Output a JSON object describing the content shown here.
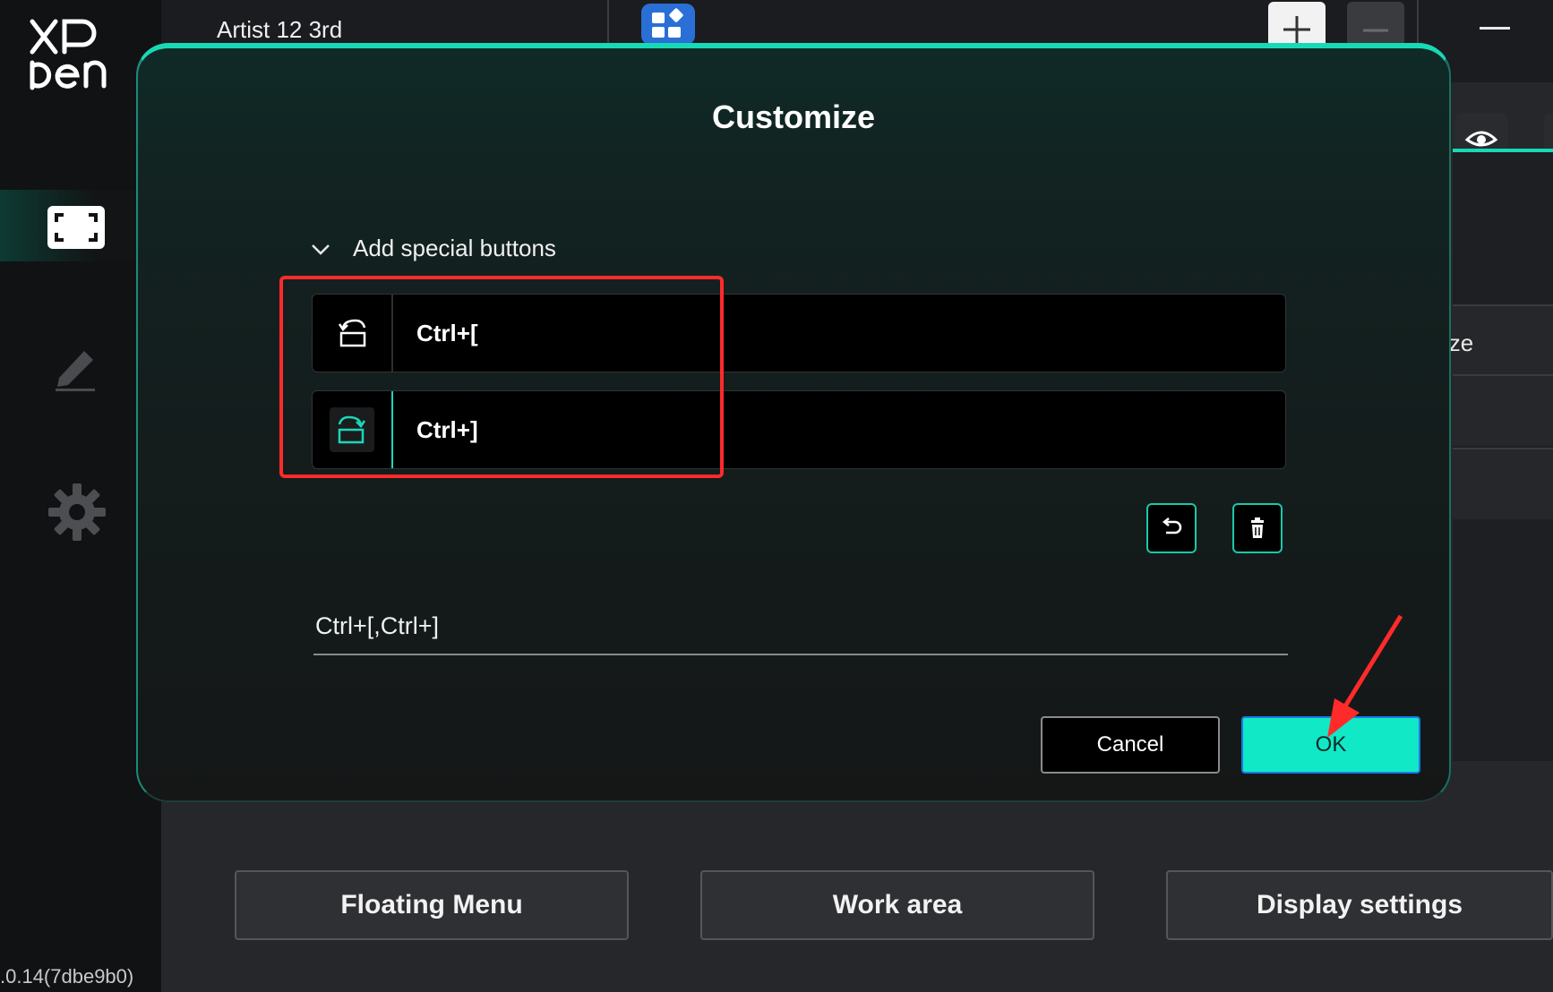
{
  "sidebar": {
    "logo": "XP pen",
    "icons": [
      "display-icon",
      "pen-icon",
      "settings-gear-icon"
    ],
    "version": ".0.14(7dbe9b0)"
  },
  "topbar": {
    "device_name": "Artist 12 3rd",
    "icons": [
      "app-grid-icon",
      "plus-icon",
      "minus-icon",
      "window-minimize-icon"
    ]
  },
  "background": {
    "peek_text": "ize",
    "buttons": [
      "Floating Menu",
      "Work area",
      "Display settings"
    ]
  },
  "modal": {
    "title": "Customize",
    "section_label": "Add special buttons",
    "keys": [
      {
        "icon": "rotate-left-icon",
        "label": "Ctrl+["
      },
      {
        "icon": "rotate-right-icon",
        "label": "Ctrl+]"
      }
    ],
    "input_value": "Ctrl+[,Ctrl+]",
    "cancel_label": "Cancel",
    "ok_label": "OK"
  },
  "colors": {
    "accent": "#19d8b8",
    "ok_button": "#11e8c6",
    "highlight": "#ff2b2b"
  }
}
